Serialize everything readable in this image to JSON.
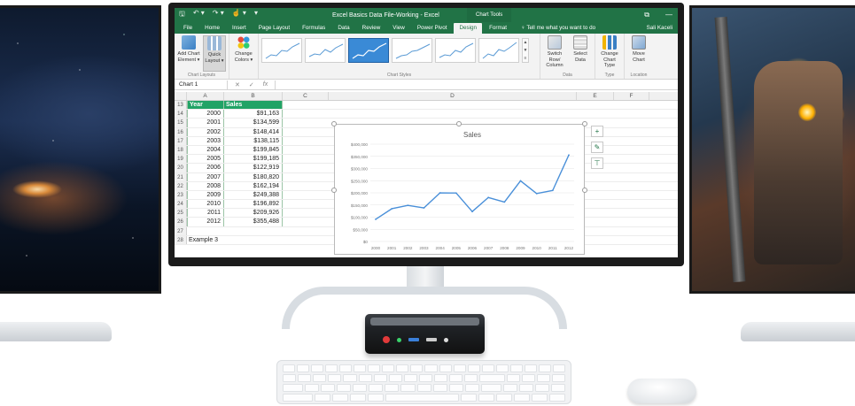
{
  "window": {
    "title": "Excel Basics Data File-Working - Excel",
    "contextual_tab_group": "Chart Tools",
    "quick_access": {
      "save": "🖫",
      "undo": "↶ ▾",
      "redo": "↷ ▾",
      "touch": "☝ ▾",
      "customize": "▾"
    },
    "window_controls": {
      "ribbon_display": "⧉",
      "minimize": "—"
    }
  },
  "ribbon_tabs": [
    {
      "label": "File"
    },
    {
      "label": "Home"
    },
    {
      "label": "Insert"
    },
    {
      "label": "Page Layout"
    },
    {
      "label": "Formulas"
    },
    {
      "label": "Data"
    },
    {
      "label": "Review"
    },
    {
      "label": "View"
    },
    {
      "label": "Power Pivot"
    },
    {
      "label": "Design",
      "active": true
    },
    {
      "label": "Format"
    }
  ],
  "tell_me": "♀ Tell me what you want to do",
  "user_name": "Sali Kaceli",
  "ribbon": {
    "chart_layouts": {
      "add_chart_element": "Add Chart Element ▾",
      "quick_layout": "Quick Layout ▾",
      "group_label": "Chart Layouts"
    },
    "change_colors": "Change Colors ▾",
    "chart_styles_label": "Chart Styles",
    "data": {
      "switch_row_column": "Switch Row/ Column",
      "select_data": "Select Data",
      "group_label": "Data"
    },
    "type": {
      "change_chart_type": "Change Chart Type",
      "group_label": "Type"
    },
    "location": {
      "move_chart": "Move Chart",
      "group_label": "Location"
    }
  },
  "formula_bar": {
    "name_box": "Chart 1",
    "cancel": "✕",
    "enter": "✓",
    "fx": "fx"
  },
  "columns": [
    "A",
    "B",
    "C",
    "D",
    "E",
    "F"
  ],
  "table": {
    "header": {
      "row": "13",
      "a": "Year",
      "b": "Sales"
    },
    "rows": [
      {
        "row": "14",
        "a": "2000",
        "b": "$91,163"
      },
      {
        "row": "15",
        "a": "2001",
        "b": "$134,599"
      },
      {
        "row": "16",
        "a": "2002",
        "b": "$148,414"
      },
      {
        "row": "17",
        "a": "2003",
        "b": "$138,115"
      },
      {
        "row": "18",
        "a": "2004",
        "b": "$199,845"
      },
      {
        "row": "19",
        "a": "2005",
        "b": "$199,185"
      },
      {
        "row": "20",
        "a": "2006",
        "b": "$122,919"
      },
      {
        "row": "21",
        "a": "2007",
        "b": "$180,820"
      },
      {
        "row": "22",
        "a": "2008",
        "b": "$162,194"
      },
      {
        "row": "23",
        "a": "2009",
        "b": "$249,388"
      },
      {
        "row": "24",
        "a": "2010",
        "b": "$196,892"
      },
      {
        "row": "25",
        "a": "2011",
        "b": "$209,926"
      },
      {
        "row": "26",
        "a": "2012",
        "b": "$355,488"
      }
    ],
    "trailing_rows": [
      {
        "row": "27",
        "a": ""
      },
      {
        "row": "28",
        "a": "Example 3"
      }
    ]
  },
  "chart_side_buttons": {
    "elements": "+",
    "styles": "✎",
    "filters": "⊤"
  },
  "chart_data": {
    "type": "line",
    "title": "Sales",
    "categories": [
      "2000",
      "2001",
      "2002",
      "2003",
      "2004",
      "2005",
      "2006",
      "2007",
      "2008",
      "2009",
      "2010",
      "2011",
      "2012"
    ],
    "series": [
      {
        "values": [
          91163,
          134599,
          148414,
          138115,
          199845,
          199185,
          122919,
          180820,
          162194,
          249388,
          196892,
          209926,
          355488
        ]
      }
    ],
    "y_ticks": [
      "$0",
      "$50,000",
      "$100,000",
      "$150,000",
      "$200,000",
      "$250,000",
      "$300,000",
      "$350,000",
      "$400,000"
    ],
    "ylim": [
      0,
      400000
    ],
    "grid": true,
    "line_color": "#4a90d9"
  },
  "colors": {
    "excel_green": "#217346",
    "table_header": "#21a366",
    "accent_blue": "#3a8ad6"
  }
}
